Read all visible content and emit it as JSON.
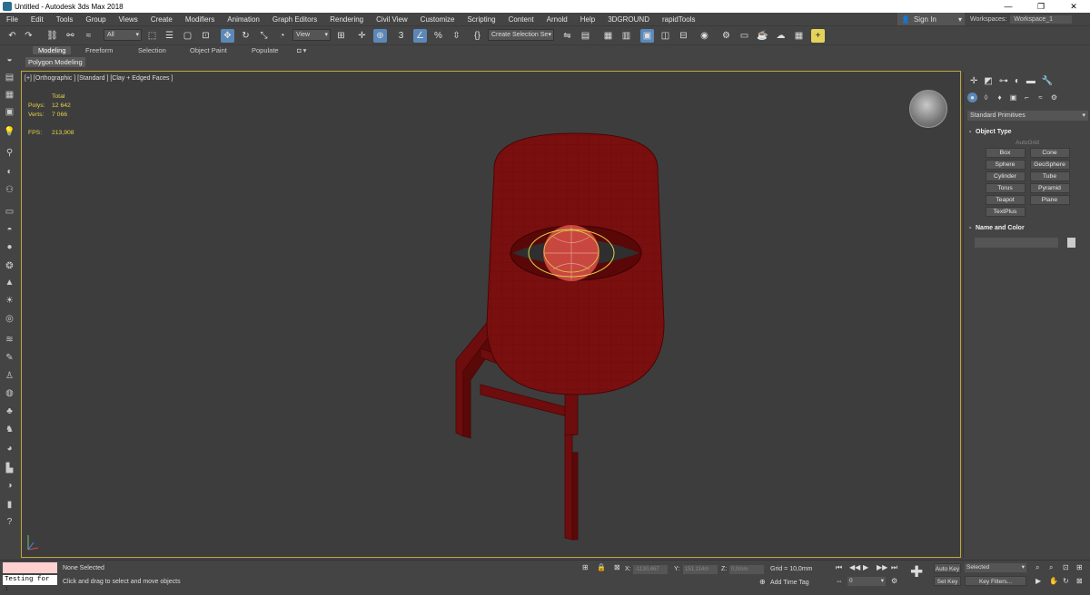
{
  "window": {
    "title": "Untitled - Autodesk 3ds Max 2018",
    "minimize": "—",
    "maximize": "❐",
    "close": "✕"
  },
  "menu": [
    "File",
    "Edit",
    "Tools",
    "Group",
    "Views",
    "Create",
    "Modifiers",
    "Animation",
    "Graph Editors",
    "Rendering",
    "Civil View",
    "Customize",
    "Scripting",
    "Content",
    "Arnold",
    "Help",
    "3DGROUND",
    "rapidTools"
  ],
  "signin": {
    "label": "Sign In"
  },
  "workspaces": {
    "label": "Workspaces:",
    "value": "Workspace_1"
  },
  "toolbar": {
    "filter": "All",
    "ref_coord": "View",
    "selection_set": "Create Selection Se"
  },
  "ribbon": {
    "tabs": [
      "Modeling",
      "Freeform",
      "Selection",
      "Object Paint",
      "Populate"
    ],
    "active_tab": "Modeling",
    "sub": "Polygon Modeling"
  },
  "viewport": {
    "label": "[+] [Orthographic ] [Standard ] [Clay + Edged Faces ]",
    "stats_header": "Total",
    "stats": [
      {
        "k": "Polys:",
        "v": "12 642"
      },
      {
        "k": "Verts:",
        "v": "7 066"
      }
    ],
    "fps_label": "FPS:",
    "fps": "213,908",
    "model_color": "#7a0f0f"
  },
  "command_panel": {
    "category": "Standard Primitives",
    "object_type_title": "Object Type",
    "autogrid": "AutoGrid",
    "primitives": [
      "Box",
      "Cone",
      "Sphere",
      "GeoSphere",
      "Cylinder",
      "Tube",
      "Torus",
      "Pyramid",
      "Teapot",
      "Plane",
      "TextPlus"
    ],
    "name_color_title": "Name and Color"
  },
  "status": {
    "maxscript": "Testing for :",
    "selection": "None Selected",
    "prompt": "Click and drag to select and move objects",
    "x_label": "X:",
    "x_value": "-1130,467",
    "y_label": "Y:",
    "y_value": "151,114m",
    "z_label": "Z:",
    "z_value": "0,0mm",
    "grid": "Grid = 10,0mm",
    "add_time_tag": "Add Time Tag",
    "frame": "0",
    "auto_key": "Auto Key",
    "selected": "Selected",
    "set_key": "Set Key",
    "key_filters": "Key Filters..."
  }
}
